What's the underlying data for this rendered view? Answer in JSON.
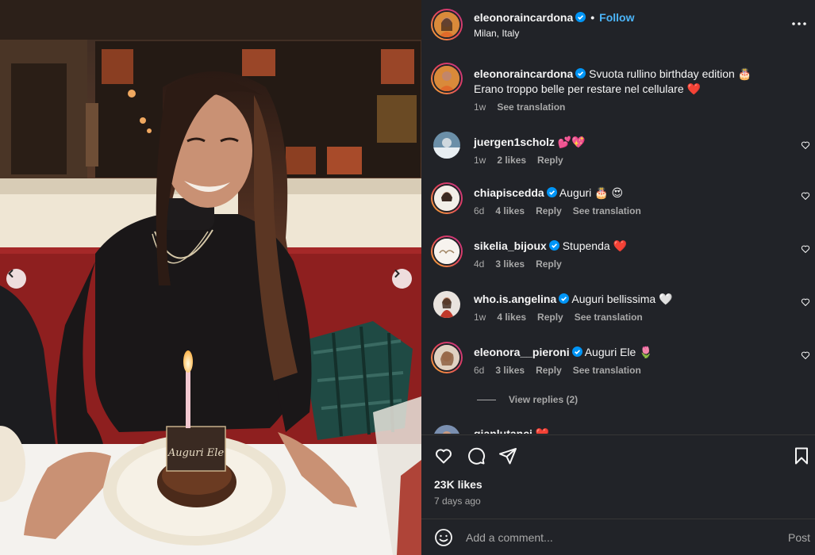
{
  "colors": {
    "panel_bg": "#212328",
    "link_blue": "#4cb5f9",
    "verified_blue": "#0095f6",
    "muted": "#a8a8a8",
    "text": "#f5f5f5"
  },
  "photo": {
    "cake_sign_text": "Auguri Ele"
  },
  "header": {
    "username": "eleonoraincardona",
    "dot": "•",
    "follow_label": "Follow",
    "location": "Milan, Italy"
  },
  "caption": {
    "username": "eleonoraincardona",
    "line1": "Svuota rullino birthday edition 🎂",
    "line2": "Erano troppo belle per restare nel cellulare ❤️",
    "time": "1w",
    "see_translation": "See translation"
  },
  "comments": [
    {
      "username": "juergen1scholz",
      "verified": false,
      "text": "💕💖",
      "time": "1w",
      "likes": "2 likes",
      "reply": "Reply",
      "translation": ""
    },
    {
      "username": "chiapiscedda",
      "verified": true,
      "text": "Auguri 🎂 😍",
      "time": "6d",
      "likes": "4 likes",
      "reply": "Reply",
      "translation": "See translation"
    },
    {
      "username": "sikelia_bijoux",
      "verified": true,
      "text": "Stupenda ❤️",
      "time": "4d",
      "likes": "3 likes",
      "reply": "Reply",
      "translation": ""
    },
    {
      "username": "who.is.angelina",
      "verified": true,
      "text": "Auguri bellissima 🤍",
      "time": "1w",
      "likes": "4 likes",
      "reply": "Reply",
      "translation": "See translation"
    },
    {
      "username": "eleonora__pieroni",
      "verified": true,
      "text": "Auguri Ele 🌷",
      "time": "6d",
      "likes": "3 likes",
      "reply": "Reply",
      "translation": "See translation"
    },
    {
      "username": "gianlutanci",
      "verified": false,
      "text": "❤️",
      "time": "",
      "likes": "",
      "reply": "",
      "translation": ""
    }
  ],
  "view_replies": "View replies (2)",
  "likes": "23K likes",
  "posted_ago": "7 days ago",
  "comment_box": {
    "placeholder": "Add a comment...",
    "post_label": "Post"
  },
  "icons": {
    "more": "more-horizontal-icon",
    "like": "heart-icon",
    "comment": "comment-bubble-icon",
    "share": "paper-plane-icon",
    "save": "bookmark-icon",
    "emoji": "emoji-smiley-icon",
    "prev": "chevron-left-icon",
    "next": "chevron-right-icon"
  }
}
